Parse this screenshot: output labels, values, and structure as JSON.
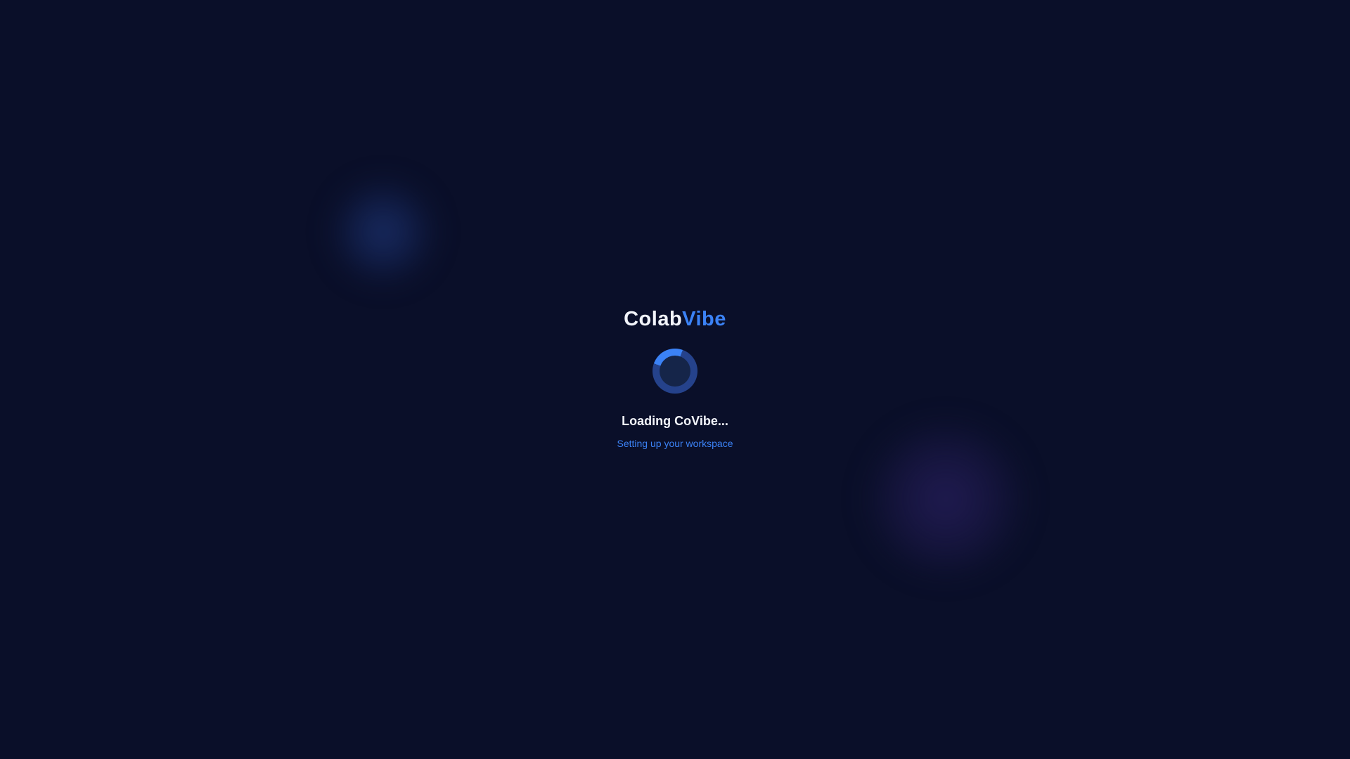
{
  "app": {
    "brand_part1": "Colab",
    "brand_part2": "Vibe"
  },
  "loading": {
    "title": "Loading CoVibe...",
    "subtitle": "Setting up your workspace",
    "spinner_icon": "loading-spinner"
  },
  "colors": {
    "background": "#0a0f29",
    "accent": "#3b82f6",
    "text": "#f2f4fa"
  }
}
